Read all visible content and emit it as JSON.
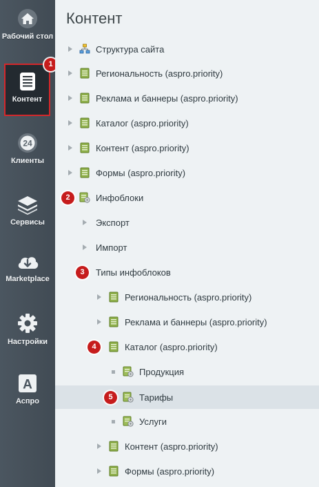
{
  "sidebar": {
    "items": [
      {
        "label": "Рабочий стол",
        "icon": "home-icon"
      },
      {
        "label": "Контент",
        "icon": "document-icon"
      },
      {
        "label": "Клиенты",
        "icon": "clients-24-icon"
      },
      {
        "label": "Сервисы",
        "icon": "layers-icon"
      },
      {
        "label": "Marketplace",
        "icon": "cloud-download-icon"
      },
      {
        "label": "Настройки",
        "icon": "gear-icon"
      },
      {
        "label": "Аспро",
        "icon": "aspro-a-icon"
      }
    ],
    "badge": "1"
  },
  "main": {
    "title": "Контент",
    "tree": [
      {
        "label": "Структура сайта"
      },
      {
        "label": "Региональность (aspro.priority)"
      },
      {
        "label": "Реклама и баннеры (aspro.priority)"
      },
      {
        "label": "Каталог (aspro.priority)"
      },
      {
        "label": "Контент (aspro.priority)"
      },
      {
        "label": "Формы (aspro.priority)"
      },
      {
        "label": "Инфоблоки",
        "badge": "2"
      },
      {
        "label": "Экспорт"
      },
      {
        "label": "Импорт"
      },
      {
        "label": "Типы инфоблоков",
        "badge": "3"
      },
      {
        "label": "Региональность (aspro.priority)"
      },
      {
        "label": "Реклама и баннеры (aspro.priority)"
      },
      {
        "label": "Каталог (aspro.priority)",
        "badge": "4"
      },
      {
        "label": "Продукция"
      },
      {
        "label": "Тарифы",
        "badge": "5",
        "selected": true
      },
      {
        "label": "Услуги"
      },
      {
        "label": "Контент (aspro.priority)"
      },
      {
        "label": "Формы (aspro.priority)"
      }
    ]
  },
  "colors": {
    "sidebar_bg": "#454f58",
    "active_border": "#d6272a",
    "badge": "#c61c1c",
    "main_bg": "#eef2f4",
    "selected_row": "#dbe2e7"
  }
}
